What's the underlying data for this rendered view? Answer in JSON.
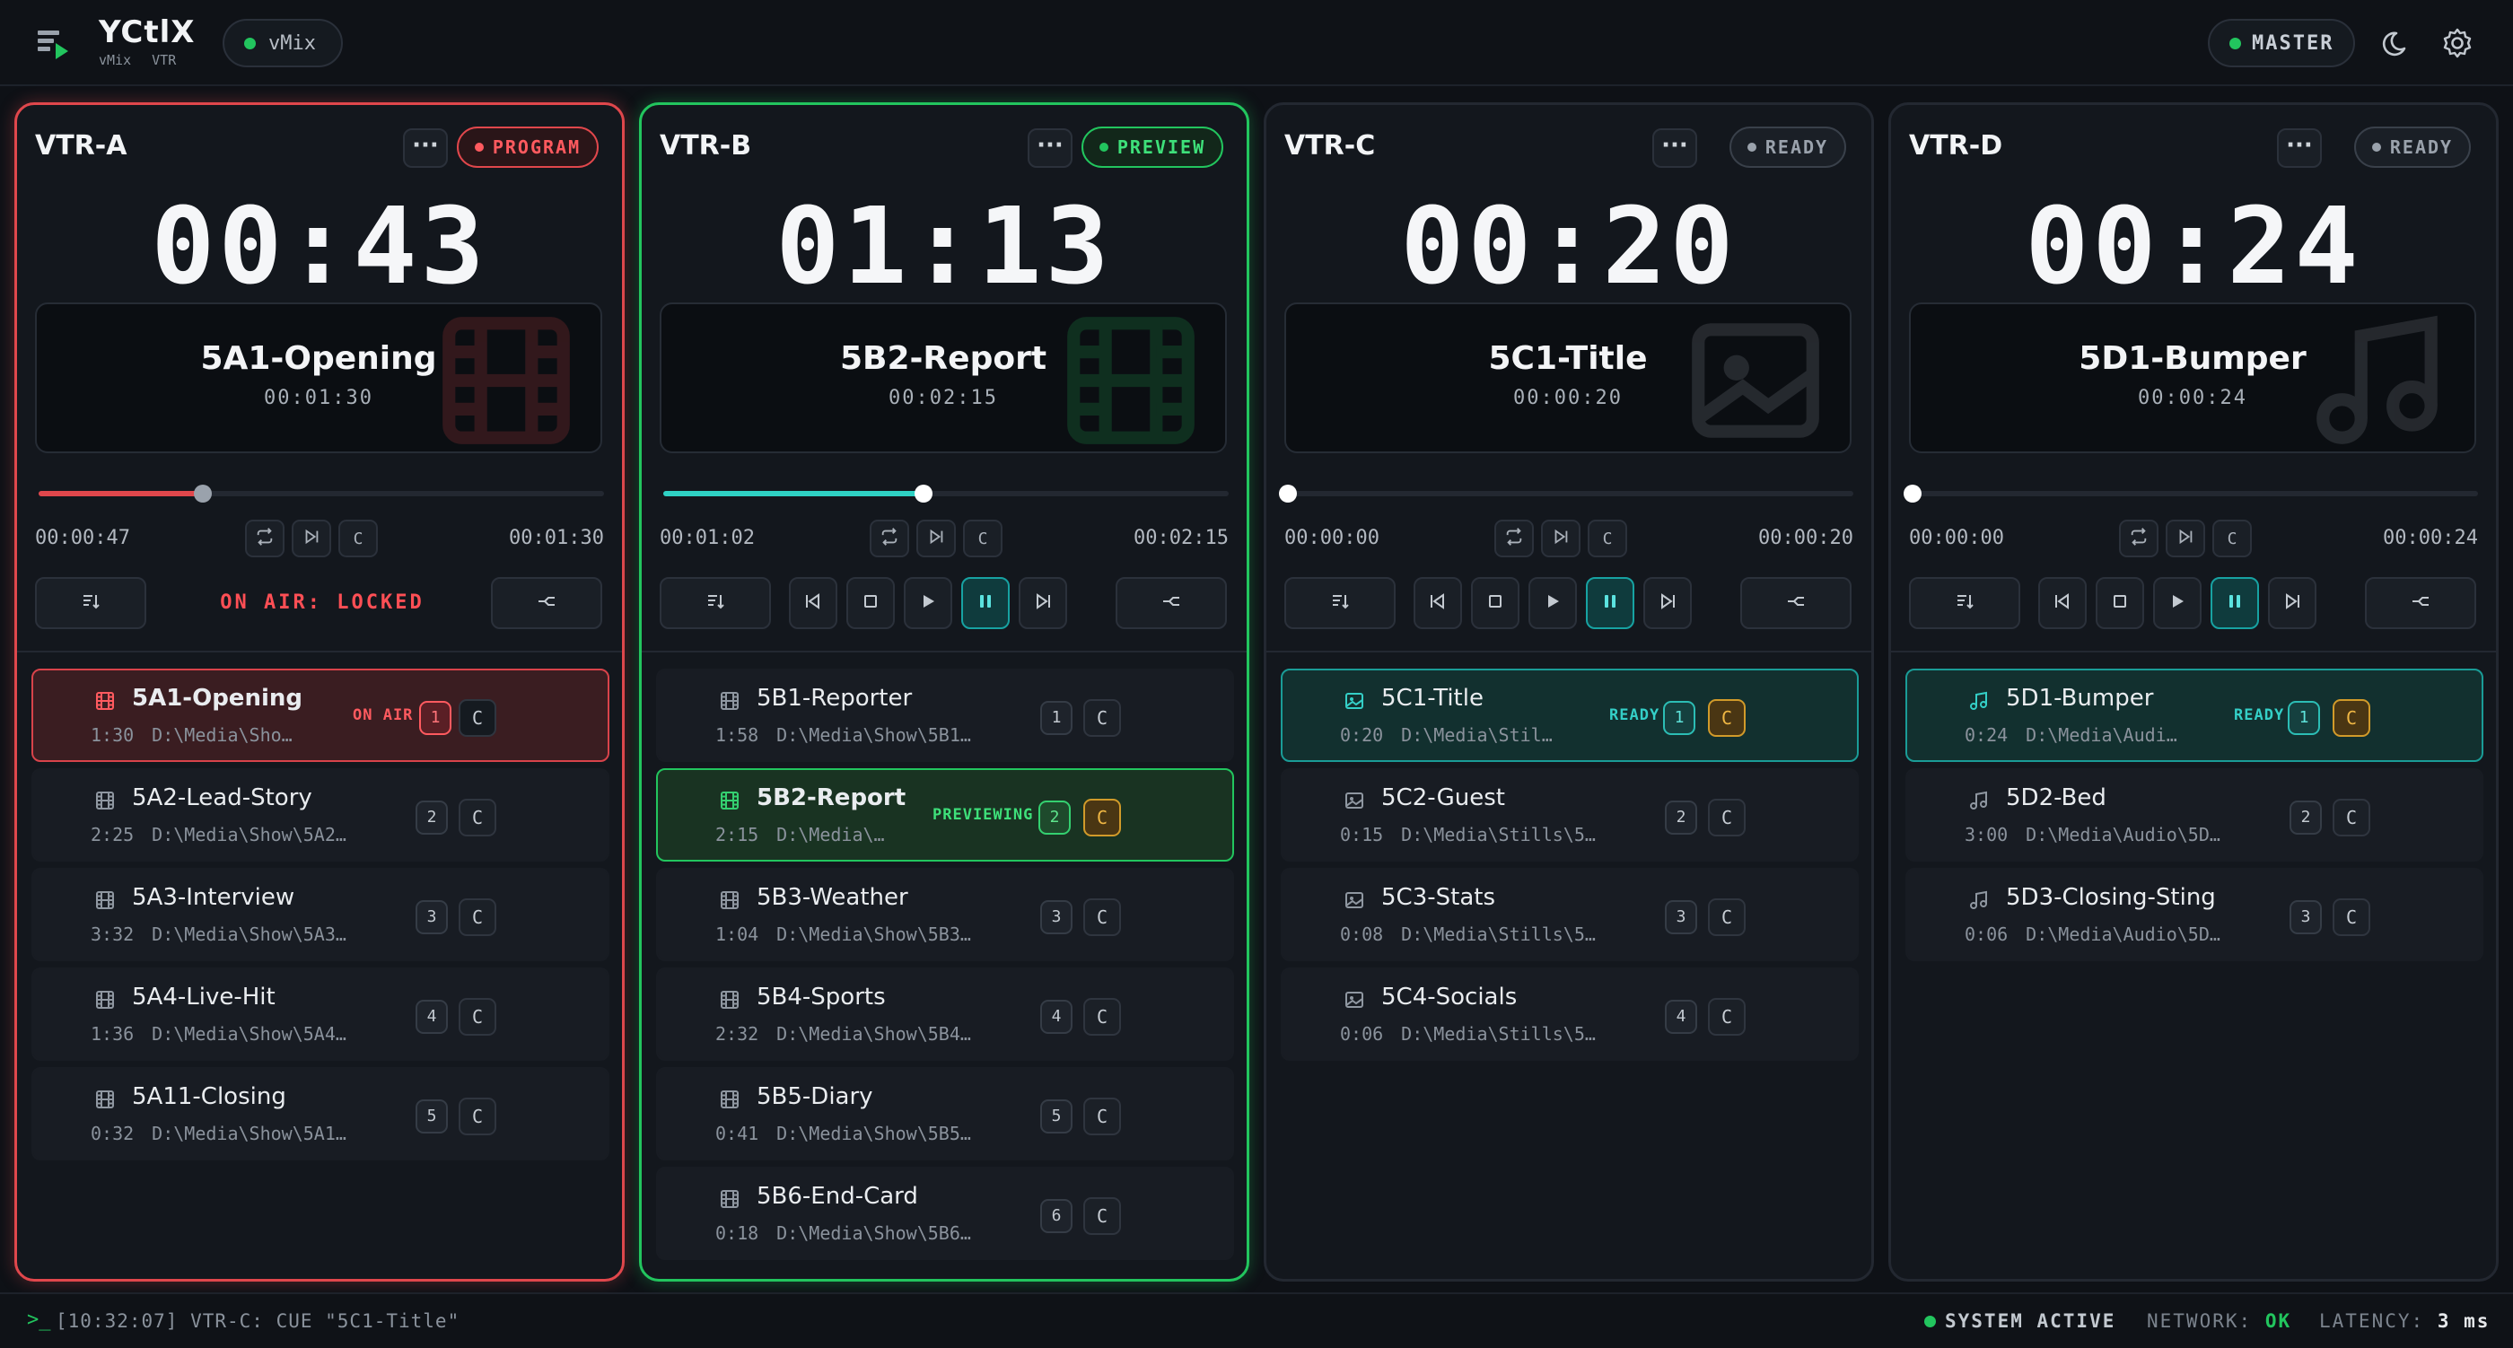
{
  "app": {
    "title": "YCtlX",
    "sub_1": "vMix",
    "sub_2": "VTR",
    "vmix_label": "vMix",
    "master_label": "MASTER"
  },
  "colors": {
    "program": "#e0474c",
    "preview": "#22c55e",
    "ready": "#1a9c97",
    "amber": "#d19a2a"
  },
  "vtrs": [
    {
      "name": "VTR-A",
      "state": "program",
      "badge": "PROGRAM",
      "timer": "00:43",
      "clip": {
        "name": "5A1-Opening",
        "duration": "00:01:30",
        "ghost_icon": "film-icon"
      },
      "progress": 0.29,
      "elapsed": "00:00:47",
      "total": "00:01:30",
      "lock_text": "ON AIR: LOCKED",
      "items": [
        {
          "name": "5A1-Opening",
          "time": "1:30",
          "path": "D:\\Media\\Sho…",
          "num": "1",
          "cue": "C",
          "status": "ON AIR",
          "state": "program",
          "icon": "film-icon"
        },
        {
          "name": "5A2-Lead-Story",
          "time": "2:25",
          "path": "D:\\Media\\Show\\5A2…",
          "num": "2",
          "cue": "C",
          "state": "",
          "icon": "film-icon"
        },
        {
          "name": "5A3-Interview",
          "time": "3:32",
          "path": "D:\\Media\\Show\\5A3…",
          "num": "3",
          "cue": "C",
          "state": "",
          "icon": "film-icon"
        },
        {
          "name": "5A4-Live-Hit",
          "time": "1:36",
          "path": "D:\\Media\\Show\\5A4…",
          "num": "4",
          "cue": "C",
          "state": "",
          "icon": "film-icon"
        },
        {
          "name": "5A11-Closing",
          "time": "0:32",
          "path": "D:\\Media\\Show\\5A1…",
          "num": "5",
          "cue": "C",
          "state": "",
          "icon": "film-icon"
        }
      ]
    },
    {
      "name": "VTR-B",
      "state": "preview",
      "badge": "PREVIEW",
      "timer": "01:13",
      "clip": {
        "name": "5B2-Report",
        "duration": "00:02:15",
        "ghost_icon": "film-icon"
      },
      "progress": 0.46,
      "elapsed": "00:01:02",
      "total": "00:02:15",
      "items": [
        {
          "name": "5B1-Reporter",
          "time": "1:58",
          "path": "D:\\Media\\Show\\5B1…",
          "num": "1",
          "cue": "C",
          "state": "",
          "icon": "film-icon"
        },
        {
          "name": "5B2-Report",
          "time": "2:15",
          "path": "D:\\Media\\…",
          "num": "2",
          "cue": "C",
          "status": "PREVIEWING",
          "state": "preview",
          "icon": "film-icon"
        },
        {
          "name": "5B3-Weather",
          "time": "1:04",
          "path": "D:\\Media\\Show\\5B3…",
          "num": "3",
          "cue": "C",
          "state": "",
          "icon": "film-icon"
        },
        {
          "name": "5B4-Sports",
          "time": "2:32",
          "path": "D:\\Media\\Show\\5B4…",
          "num": "4",
          "cue": "C",
          "state": "",
          "icon": "film-icon"
        },
        {
          "name": "5B5-Diary",
          "time": "0:41",
          "path": "D:\\Media\\Show\\5B5…",
          "num": "5",
          "cue": "C",
          "state": "",
          "icon": "film-icon"
        },
        {
          "name": "5B6-End-Card",
          "time": "0:18",
          "path": "D:\\Media\\Show\\5B6…",
          "num": "6",
          "cue": "C",
          "state": "",
          "icon": "film-icon"
        }
      ]
    },
    {
      "name": "VTR-C",
      "state": "ready",
      "badge": "READY",
      "timer": "00:20",
      "clip": {
        "name": "5C1-Title",
        "duration": "00:00:20",
        "ghost_icon": "image-icon"
      },
      "progress": 0.0,
      "elapsed": "00:00:00",
      "total": "00:00:20",
      "items": [
        {
          "name": "5C1-Title",
          "time": "0:20",
          "path": "D:\\Media\\Stil…",
          "num": "1",
          "cue": "C",
          "status": "READY",
          "state": "ready",
          "icon": "image-icon"
        },
        {
          "name": "5C2-Guest",
          "time": "0:15",
          "path": "D:\\Media\\Stills\\5…",
          "num": "2",
          "cue": "C",
          "state": "",
          "icon": "image-icon"
        },
        {
          "name": "5C3-Stats",
          "time": "0:08",
          "path": "D:\\Media\\Stills\\5…",
          "num": "3",
          "cue": "C",
          "state": "",
          "icon": "image-icon"
        },
        {
          "name": "5C4-Socials",
          "time": "0:06",
          "path": "D:\\Media\\Stills\\5…",
          "num": "4",
          "cue": "C",
          "state": "",
          "icon": "image-icon"
        }
      ]
    },
    {
      "name": "VTR-D",
      "state": "ready",
      "badge": "READY",
      "timer": "00:24",
      "clip": {
        "name": "5D1-Bumper",
        "duration": "00:00:24",
        "ghost_icon": "music-icon"
      },
      "progress": 0.0,
      "elapsed": "00:00:00",
      "total": "00:00:24",
      "items": [
        {
          "name": "5D1-Bumper",
          "time": "0:24",
          "path": "D:\\Media\\Audi…",
          "num": "1",
          "cue": "C",
          "status": "READY",
          "state": "ready",
          "icon": "music-icon"
        },
        {
          "name": "5D2-Bed",
          "time": "3:00",
          "path": "D:\\Media\\Audio\\5D…",
          "num": "2",
          "cue": "C",
          "state": "",
          "icon": "music-icon"
        },
        {
          "name": "5D3-Closing-Sting",
          "time": "0:06",
          "path": "D:\\Media\\Audio\\5D…",
          "num": "3",
          "cue": "C",
          "state": "",
          "icon": "music-icon"
        }
      ]
    }
  ],
  "footer": {
    "log": "[10:32:07] VTR-C: CUE \"5C1-Title\"",
    "system": "SYSTEM ACTIVE",
    "network_label": "NETWORK:",
    "network_value": "OK",
    "latency_label": "LATENCY:",
    "latency_value": "3 ms"
  }
}
